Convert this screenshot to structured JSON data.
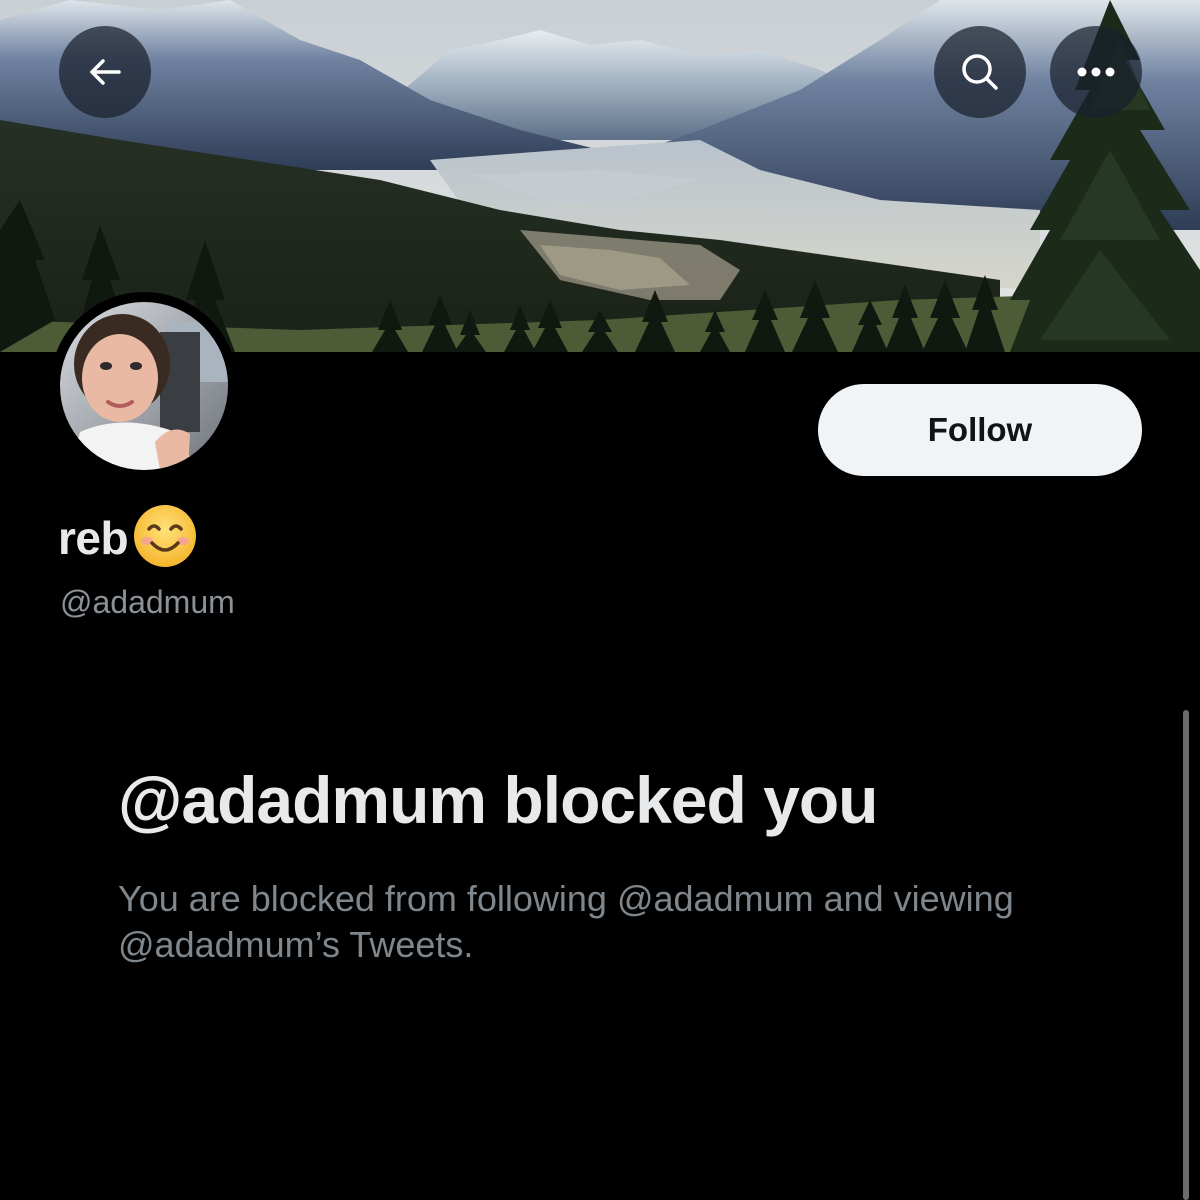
{
  "header": {
    "banner_icon": "mountain-landscape-banner",
    "back_icon": "arrow-left-icon",
    "search_icon": "search-icon",
    "more_icon": "more-dots-icon"
  },
  "profile": {
    "display_name": "reb",
    "name_emoji": "smiling-face-emoji",
    "handle": "@adadmum",
    "follow_label": "Follow"
  },
  "blocked": {
    "title": "@adadmum blocked you",
    "description": "You are blocked from following @adadmum and viewing @adadmum’s Tweets."
  },
  "colors": {
    "background": "#000000",
    "follow_button_bg": "#f1f4f6",
    "primary_text": "#e7e9ea",
    "secondary_text": "#8b9196"
  }
}
